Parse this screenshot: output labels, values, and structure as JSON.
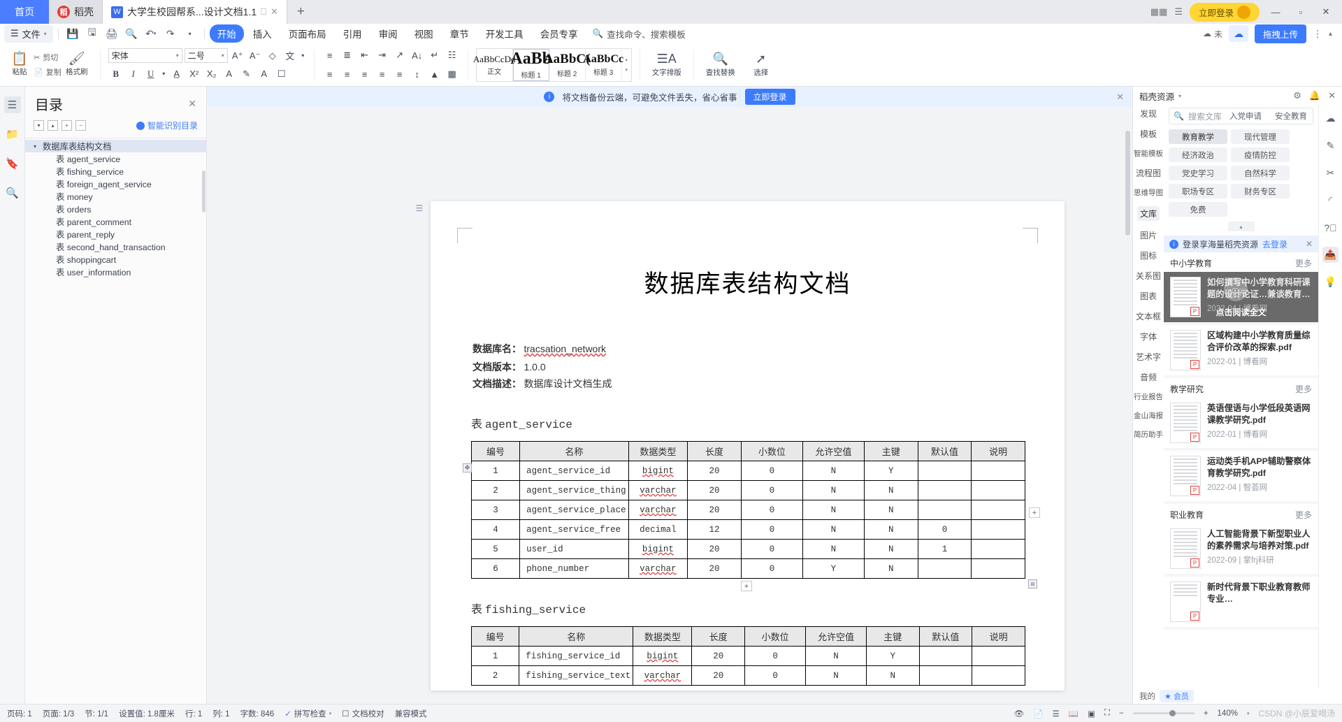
{
  "tabbar": {
    "home": "首页",
    "tabs": [
      {
        "label": "稻壳",
        "icon": "daoke-icon",
        "active": false
      },
      {
        "label": "大学生校园帮系...设计文档1.1",
        "icon": "wps-doc-icon",
        "active": true
      }
    ],
    "new_tab": "+",
    "login_label": "立即登录",
    "minimize": "—",
    "maximize": "▫",
    "close": "✕"
  },
  "ribbon_nav": {
    "file_label": "文件",
    "quick_access": [
      "save-icon",
      "save-as-icon",
      "print-icon",
      "print-preview-icon",
      "undo-icon",
      "redo-icon",
      "customize-icon"
    ],
    "tabs": [
      {
        "label": "开始",
        "active": true
      },
      {
        "label": "插入",
        "active": false
      },
      {
        "label": "页面布局",
        "active": false
      },
      {
        "label": "引用",
        "active": false
      },
      {
        "label": "审阅",
        "active": false
      },
      {
        "label": "视图",
        "active": false
      },
      {
        "label": "章节",
        "active": false
      },
      {
        "label": "开发工具",
        "active": false
      },
      {
        "label": "会员专享",
        "active": false
      }
    ],
    "search_placeholder": "查找命令、搜索模板",
    "unsync_label": "未",
    "upload_label": "拖拽上传"
  },
  "ribbon": {
    "paste": "粘贴",
    "cut": "剪切",
    "copy": "复制",
    "format_painter": "格式刷",
    "font_name": "宋体",
    "font_size": "二号",
    "style_gallery": [
      {
        "preview": "AaBbCcDd",
        "label": "正文",
        "size": "13px",
        "selected": false
      },
      {
        "preview": "AaBb",
        "label": "标题 1",
        "size": "24px",
        "selected": true
      },
      {
        "preview": "AaBbC(",
        "label": "标题 2",
        "size": "19px",
        "selected": false
      },
      {
        "preview": "AaBbCc",
        "label": "标题 3",
        "size": "16px",
        "selected": false
      }
    ],
    "text_layout": "文字排版",
    "find_replace": "查找替换",
    "select": "选择"
  },
  "left_rail": [
    {
      "icon": "outline-icon",
      "active": true
    },
    {
      "icon": "folder-icon",
      "active": false
    },
    {
      "icon": "bookmark-icon",
      "active": false
    },
    {
      "icon": "search-icon",
      "active": false
    }
  ],
  "toc": {
    "title": "目录",
    "ai_label": "智能识别目录",
    "tools": [
      "expand-down-icon",
      "collapse-up-icon",
      "plus-icon",
      "minus-icon"
    ],
    "items": [
      {
        "label": "数据库表结构文档",
        "level": 0,
        "selected": true
      },
      {
        "label": "表 agent_service",
        "level": 1,
        "selected": false
      },
      {
        "label": "表 fishing_service",
        "level": 1,
        "selected": false
      },
      {
        "label": "表 foreign_agent_service",
        "level": 1,
        "selected": false
      },
      {
        "label": "表 money",
        "level": 1,
        "selected": false
      },
      {
        "label": "表 orders",
        "level": 1,
        "selected": false
      },
      {
        "label": "表 parent_comment",
        "level": 1,
        "selected": false
      },
      {
        "label": "表 parent_reply",
        "level": 1,
        "selected": false
      },
      {
        "label": "表 second_hand_transaction",
        "level": 1,
        "selected": false
      },
      {
        "label": "表 shoppingcart",
        "level": 1,
        "selected": false
      },
      {
        "label": "表 user_information",
        "level": 1,
        "selected": false
      }
    ]
  },
  "notice": {
    "text": "将文档备份云端，可避免文件丢失，省心省事",
    "button": "立即登录"
  },
  "document": {
    "title": "数据库表结构文档",
    "meta": [
      {
        "key": "数据库名：",
        "value": "tracsation_network",
        "spell_error": true
      },
      {
        "key": "文档版本：",
        "value": "1.0.0",
        "spell_error": false
      },
      {
        "key": "文档描述：",
        "value": "数据库设计文档生成",
        "spell_error": false
      }
    ],
    "sections": [
      {
        "prefix": "表",
        "name": "agent_service",
        "headers": [
          "编号",
          "名称",
          "数据类型",
          "长度",
          "小数位",
          "允许空值",
          "主键",
          "默认值",
          "说明"
        ],
        "rows": [
          [
            "1",
            "agent_service_id",
            "bigint",
            "20",
            "0",
            "N",
            "Y",
            "",
            ""
          ],
          [
            "2",
            "agent_service_thing",
            "varchar",
            "20",
            "0",
            "N",
            "N",
            "",
            ""
          ],
          [
            "3",
            "agent_service_place",
            "varchar",
            "20",
            "0",
            "N",
            "N",
            "",
            ""
          ],
          [
            "4",
            "agent_service_free",
            "decimal",
            "12",
            "0",
            "N",
            "N",
            "0",
            ""
          ],
          [
            "5",
            "user_id",
            "bigint",
            "20",
            "0",
            "N",
            "N",
            "1",
            ""
          ],
          [
            "6",
            "phone_number",
            "varchar",
            "20",
            "0",
            "Y",
            "N",
            "",
            ""
          ]
        ]
      },
      {
        "prefix": "表",
        "name": "fishing_service",
        "headers": [
          "编号",
          "名称",
          "数据类型",
          "长度",
          "小数位",
          "允许空值",
          "主键",
          "默认值",
          "说明"
        ],
        "rows": [
          [
            "1",
            "fishing_service_id",
            "bigint",
            "20",
            "0",
            "N",
            "Y",
            "",
            ""
          ],
          [
            "2",
            "fishing_service_text",
            "varchar",
            "20",
            "0",
            "N",
            "N",
            "",
            ""
          ]
        ]
      }
    ]
  },
  "right_panel": {
    "header": "稻壳资源",
    "header_icons": [
      "gear-icon",
      "bell-icon",
      "close-icon"
    ],
    "nav": [
      {
        "label": "发现",
        "active": false
      },
      {
        "label": "模板",
        "active": false
      },
      {
        "label": "智能模板",
        "active": false
      },
      {
        "label": "流程图",
        "active": false
      },
      {
        "label": "思维导图",
        "active": false
      },
      {
        "label": "文库",
        "active": true
      },
      {
        "label": "图片",
        "active": false
      },
      {
        "label": "图标",
        "active": false
      },
      {
        "label": "关系图",
        "active": false
      },
      {
        "label": "图表",
        "active": false
      },
      {
        "label": "文本框",
        "active": false
      },
      {
        "label": "字体",
        "active": false
      },
      {
        "label": "艺术字",
        "active": false
      },
      {
        "label": "音频",
        "active": false
      },
      {
        "label": "行业报告",
        "active": false
      },
      {
        "label": "金山海报",
        "active": false
      },
      {
        "label": "简历助手",
        "active": false
      }
    ],
    "search_placeholder": "搜索文库",
    "search_chips": [
      "入党申请",
      "安全教育"
    ],
    "category_chips": [
      {
        "label": "教育教学",
        "active": true
      },
      {
        "label": "现代管理",
        "active": false
      },
      {
        "label": "经济政治",
        "active": false
      },
      {
        "label": "疫情防控",
        "active": false
      },
      {
        "label": "党史学习",
        "active": false
      },
      {
        "label": "自然科学",
        "active": false
      },
      {
        "label": "职场专区",
        "active": false
      },
      {
        "label": "财务专区",
        "active": false
      },
      {
        "label": "免费",
        "active": false
      }
    ],
    "login_bar": {
      "text": "登录享海量稻壳资源",
      "link": "去登录"
    },
    "sections": [
      {
        "name": "中小学教育",
        "more": "更多",
        "cards": [
          {
            "title": "如何撰写中小学教育科研课题的设计论证…兼谈教育科研…",
            "date": "2022-04",
            "source": "博看网",
            "hovered": true,
            "hover_label": "点击阅读全文"
          },
          {
            "title": "区域构建中小学教育质量综合评价改革的探索.pdf",
            "date": "2022-01",
            "source": "博看网",
            "hovered": false
          }
        ]
      },
      {
        "name": "教学研究",
        "more": "更多",
        "cards": [
          {
            "title": "英语俚语与小学低段英语网课教学研究.pdf",
            "date": "2022-01",
            "source": "博看网",
            "hovered": false
          },
          {
            "title": "运动类手机APP辅助警察体育教学研究.pdf",
            "date": "2022-04",
            "source": "智荟网",
            "hovered": false
          }
        ]
      },
      {
        "name": "职业教育",
        "more": "更多",
        "cards": [
          {
            "title": "人工智能背景下新型职业人的素养需求与培养对策.pdf",
            "date": "2022-09",
            "source": "掌frj科研",
            "hovered": false
          },
          {
            "title": "新时代背景下职业教育教师专业…",
            "date": "",
            "source": "",
            "hovered": false
          }
        ]
      }
    ],
    "footer": {
      "mine": "我的",
      "vip": "会员"
    },
    "right_rail": [
      "cloud-icon",
      "pen-icon",
      "scissors-icon",
      "help-icon",
      "share-icon",
      "idea-icon"
    ]
  },
  "status_bar": {
    "items": [
      "页码: 1",
      "页面: 1/3",
      "节: 1/1",
      "设置值: 1.8厘米",
      "行: 1",
      "列: 1",
      "字数: 846"
    ],
    "spellcheck": "拼写检查",
    "proofread": "文档校对",
    "compat": "兼容模式",
    "zoom": "140%",
    "zoom_minus": "−",
    "zoom_plus": "+",
    "watermark": "CSDN @小辰爱喝汤"
  }
}
